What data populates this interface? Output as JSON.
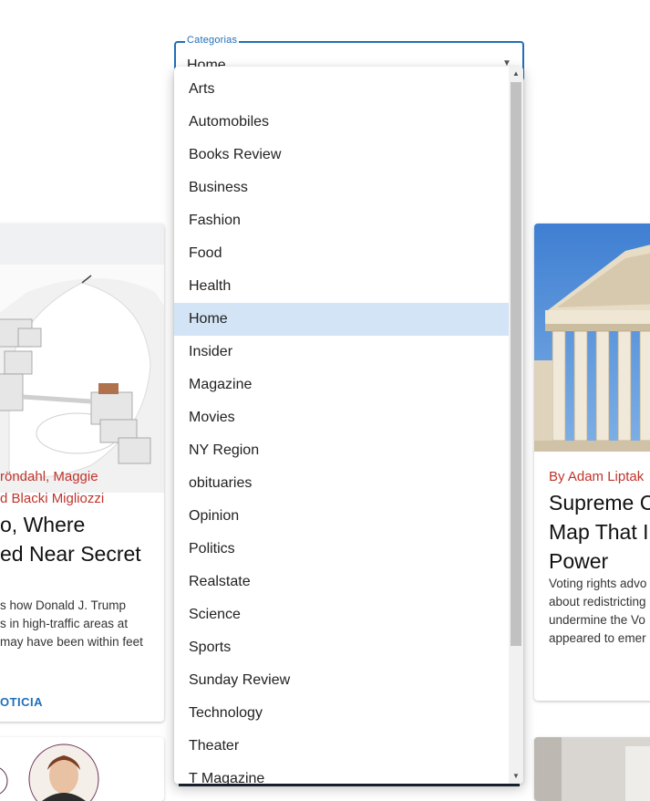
{
  "select": {
    "legend": "Categorias",
    "value": "Home"
  },
  "menu": {
    "items": [
      "Arts",
      "Automobiles",
      "Books Review",
      "Business",
      "Fashion",
      "Food",
      "Health",
      "Home",
      "Insider",
      "Magazine",
      "Movies",
      "NY Region",
      "obituaries",
      "Opinion",
      "Politics",
      "Realstate",
      "Science",
      "Sports",
      "Sunday Review",
      "Technology",
      "Theater",
      "T Magazine"
    ],
    "selected": "Home"
  },
  "left_card": {
    "byline_1": "röndahl, Maggie",
    "byline_2": "d Blacki Migliozzi",
    "headline_1": "o, Where",
    "headline_2": "ed Near Secret",
    "abstract_1": "s how Donald J. Trump",
    "abstract_2": "s in high-traffic areas at",
    "abstract_3": "may have been within feet",
    "read_more": "OTICIA"
  },
  "right_card": {
    "byline": "By Adam Liptak",
    "headline_1": "Supreme C",
    "headline_2": "Map That I",
    "headline_3": "Power",
    "abstract_1": "Voting rights advo",
    "abstract_2": "about redistricting",
    "abstract_3": "undermine the Vo",
    "abstract_4": "appeared to emer"
  },
  "icons": {
    "dropdown_arrow": "caret-down-icon",
    "scroll_up": "scroll-up-arrow-icon",
    "scroll_down": "scroll-down-arrow-icon"
  },
  "colors": {
    "accent": "#1f6fb8",
    "byline": "#c0342b",
    "selected_item": "#d2e4f5"
  }
}
